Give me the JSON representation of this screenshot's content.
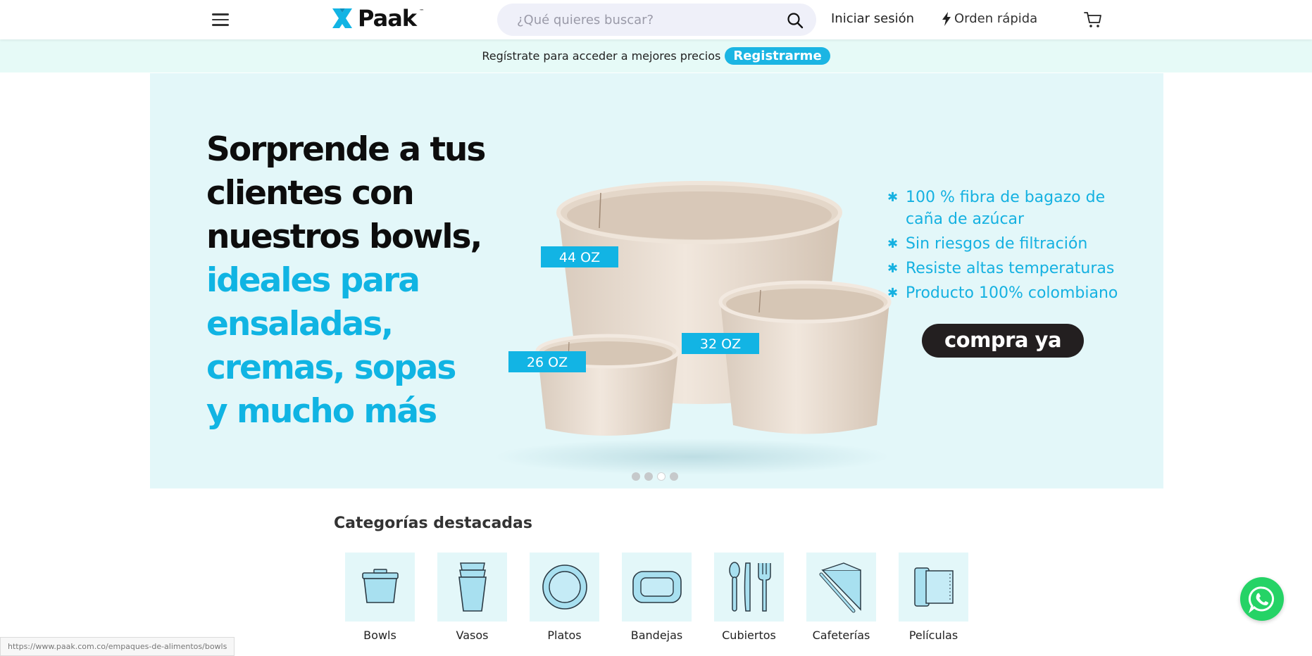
{
  "header": {
    "logo_text": "Paak",
    "logo_tm": "™",
    "search_placeholder": "¿Qué quieres buscar?",
    "login_label": "Iniciar sesión",
    "quick_order_label": "Orden rápida"
  },
  "promo": {
    "text": "Regístrate para acceder a mejores precios",
    "button_label": "Registrarme"
  },
  "hero": {
    "headline_dark": [
      "Sorprende a tus",
      "clientes con",
      "nuestros bowls,"
    ],
    "headline_blue": [
      "ideales para",
      "ensaladas,",
      "cremas, sopas",
      "y mucho más"
    ],
    "size_labels": [
      "44 OZ",
      "32 OZ",
      "26 OZ"
    ],
    "features": [
      "100 % fibra de bagazo de caña de azúcar",
      "Sin riesgos de filtración",
      "Resiste altas temperaturas",
      "Producto 100% colombiano"
    ],
    "cta_label": "compra ya",
    "slides_count": 4,
    "active_slide": 3
  },
  "categories": {
    "title": "Categorías destacadas",
    "items": [
      "Bowls",
      "Vasos",
      "Platos",
      "Bandejas",
      "Cubiertos",
      "Cafeterías",
      "Películas"
    ]
  },
  "status_bar": {
    "url": "https://www.paak.com.co/empaques-de-alimentos/bowls"
  },
  "colors": {
    "accent": "#1bb5e3",
    "hero_bg": "#e3f7f9",
    "promo_bg": "#e6faf7",
    "cta_bg": "#231f20",
    "whatsapp": "#25d366"
  }
}
